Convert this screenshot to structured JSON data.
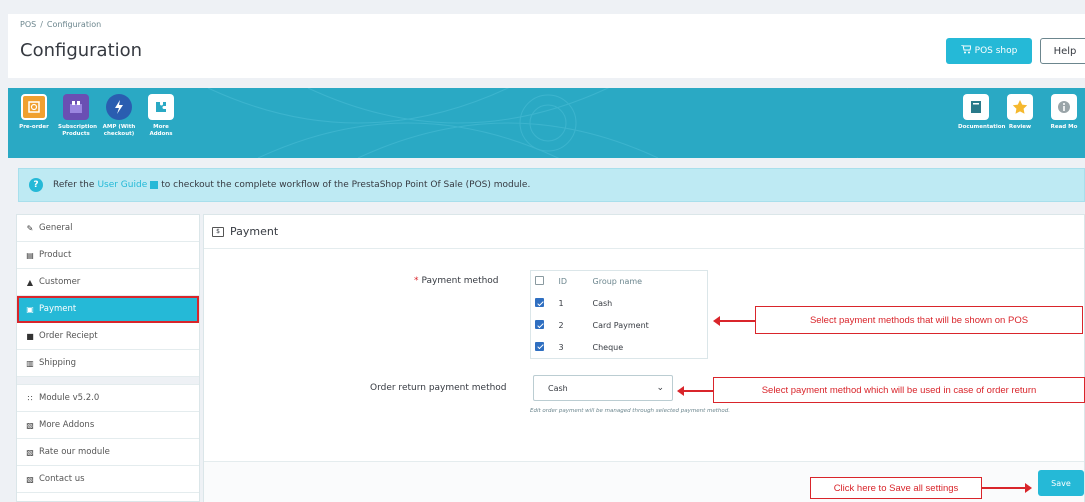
{
  "header": {
    "breadcrumb": [
      "POS",
      "Configuration"
    ],
    "title": "Configuration",
    "pos_shop_label": "POS shop",
    "help_label": "Help"
  },
  "banner": {
    "left_addons": [
      {
        "label": "Pre-order",
        "icon": "preorder-icon",
        "color": "#f0a030"
      },
      {
        "label": "Subscription Products",
        "icon": "subscription-icon",
        "color": "#6a4fb3"
      },
      {
        "label": "AMP (With checkout)",
        "icon": "amp-bolt-icon",
        "color": "#2a5db0"
      },
      {
        "label": "More Addons",
        "icon": "puzzle-icon",
        "color": "#ffffff"
      }
    ],
    "right_addons": [
      {
        "label": "Documentation",
        "icon": "documentation-icon",
        "color": "#ffffff"
      },
      {
        "label": "Review",
        "icon": "star-icon",
        "color": "#ffffff"
      },
      {
        "label": "Read Mo",
        "icon": "info-icon",
        "color": "#ffffff"
      }
    ]
  },
  "alert": {
    "prefix": "Refer the",
    "link": "User Guide",
    "suffix": "to checkout the complete workflow of the PrestaShop Point Of Sale (POS) module."
  },
  "sidebar": {
    "items": [
      {
        "label": "General",
        "icon": "wrench-icon"
      },
      {
        "label": "Product",
        "icon": "book-icon"
      },
      {
        "label": "Customer",
        "icon": "user-icon"
      },
      {
        "label": "Payment",
        "icon": "money-icon",
        "active": true
      },
      {
        "label": "Order Reciept",
        "icon": "receipt-icon"
      },
      {
        "label": "Shipping",
        "icon": "truck-icon"
      }
    ],
    "secondary": [
      {
        "label": "Module v5.2.0",
        "icon": "sitemap-icon"
      },
      {
        "label": "More Addons",
        "icon": "external-icon"
      },
      {
        "label": "Rate our module",
        "icon": "external-icon"
      },
      {
        "label": "Contact us",
        "icon": "external-icon"
      }
    ]
  },
  "panel": {
    "title": "Payment",
    "payment_method_label": "Payment method",
    "table": {
      "headers": [
        "ID",
        "Group name"
      ],
      "rows": [
        {
          "id": "1",
          "name": "Cash",
          "checked": true
        },
        {
          "id": "2",
          "name": "Card Payment",
          "checked": true
        },
        {
          "id": "3",
          "name": "Cheque",
          "checked": true
        }
      ]
    },
    "order_return_label": "Order return payment method",
    "order_return_value": "Cash",
    "help_text": "Edit order payment will be managed through selected payment method.",
    "save_label": "Save"
  },
  "annotations": {
    "payment_note": "Select payment methods that will be shown on POS",
    "return_note": "Select payment method which will be used in case of order return",
    "save_note": "Click here to Save all settings"
  },
  "colors": {
    "accent": "#25b9d7",
    "annotation": "#d9252b"
  }
}
